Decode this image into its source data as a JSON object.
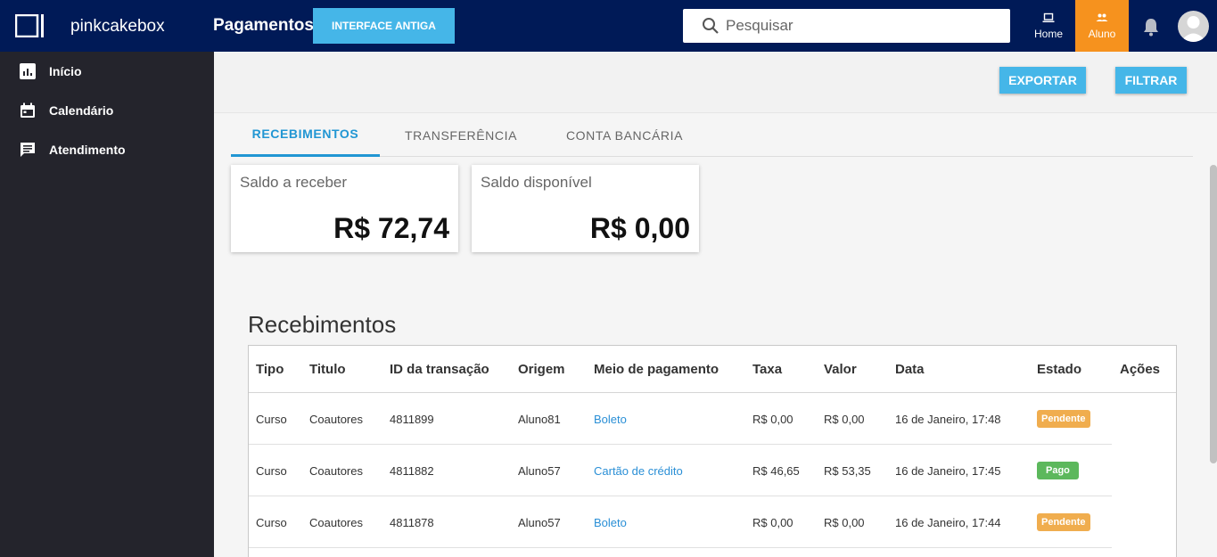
{
  "header": {
    "brand": "pinkcakebox",
    "page_title": "Pagamentos",
    "old_ui_button": "INTERFACE ANTIGA",
    "search_placeholder": "Pesquisar",
    "nav_home": "Home",
    "nav_aluno": "Aluno"
  },
  "sidebar": {
    "items": [
      {
        "label": "Início",
        "icon": "chart-icon"
      },
      {
        "label": "Calendário",
        "icon": "calendar-icon"
      },
      {
        "label": "Atendimento",
        "icon": "chat-icon"
      }
    ]
  },
  "actions": {
    "export": "EXPORTAR",
    "filter": "FILTRAR"
  },
  "tabs": [
    "RECEBIMENTOS",
    "TRANSFERÊNCIA",
    "CONTA BANCÁRIA"
  ],
  "cards": [
    {
      "label": "Saldo a receber",
      "value": "R$ 72,74"
    },
    {
      "label": "Saldo disponível",
      "value": "R$ 0,00"
    }
  ],
  "section_title": "Recebimentos",
  "table": {
    "headers": [
      "Tipo",
      "Titulo",
      "ID da transação",
      "Origem",
      "Meio de pagamento",
      "Taxa",
      "Valor",
      "Data",
      "Estado",
      "Ações"
    ],
    "rows": [
      [
        "Curso",
        "Coautores",
        "4811899",
        "Aluno81",
        "Boleto",
        "R$ 0,00",
        "R$ 0,00",
        "16 de Janeiro, 17:48",
        "Pendente"
      ],
      [
        "Curso",
        "Coautores",
        "4811882",
        "Aluno57",
        "Cartão de crédito",
        "R$ 46,65",
        "R$ 53,35",
        "16 de Janeiro, 17:45",
        "Pago"
      ],
      [
        "Curso",
        "Coautores",
        "4811878",
        "Aluno57",
        "Boleto",
        "R$ 0,00",
        "R$ 0,00",
        "16 de Janeiro, 17:44",
        "Pendente"
      ]
    ]
  },
  "colors": {
    "topbar": "#001a57",
    "accent_blue": "#45b6e8",
    "aluno_orange": "#f6921e",
    "pending": "#f0ad4e",
    "paid": "#5cb85c"
  }
}
